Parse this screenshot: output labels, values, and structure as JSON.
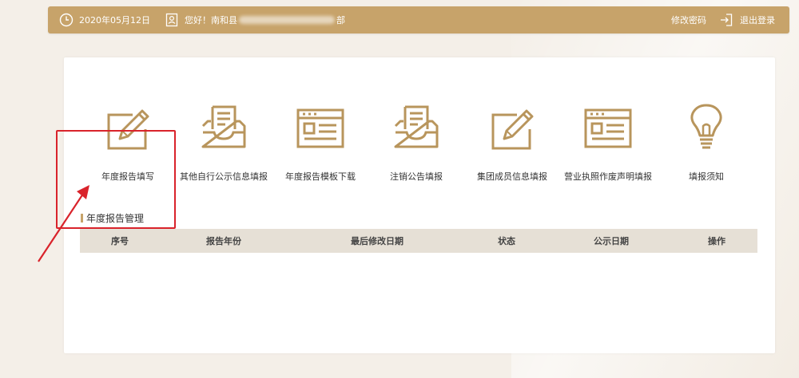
{
  "header": {
    "date": "2020年05月12日",
    "greeting": "您好！南和县",
    "user_suffix": "部",
    "change_password": "修改密码",
    "logout": "退出登录"
  },
  "menu": {
    "items": [
      {
        "label": "年度报告填写",
        "icon": "edit-icon"
      },
      {
        "label": "其他自行公示信息填报",
        "icon": "inbox-doc-icon"
      },
      {
        "label": "年度报告模板下载",
        "icon": "window-doc-icon"
      },
      {
        "label": "注销公告填报",
        "icon": "inbox-doc-icon"
      },
      {
        "label": "集团成员信息填报",
        "icon": "edit-icon"
      },
      {
        "label": "营业执照作废声明填报",
        "icon": "window-doc-icon"
      },
      {
        "label": "填报须知",
        "icon": "lightbulb-icon"
      }
    ]
  },
  "section": {
    "title": "年度报告管理"
  },
  "table": {
    "columns": [
      "序号",
      "报告年份",
      "最后修改日期",
      "状态",
      "公示日期",
      "操作"
    ],
    "rows": []
  },
  "colors": {
    "accent": "#c7a36a",
    "highlight": "#d9232b",
    "table_header": "#e6e0d6"
  }
}
